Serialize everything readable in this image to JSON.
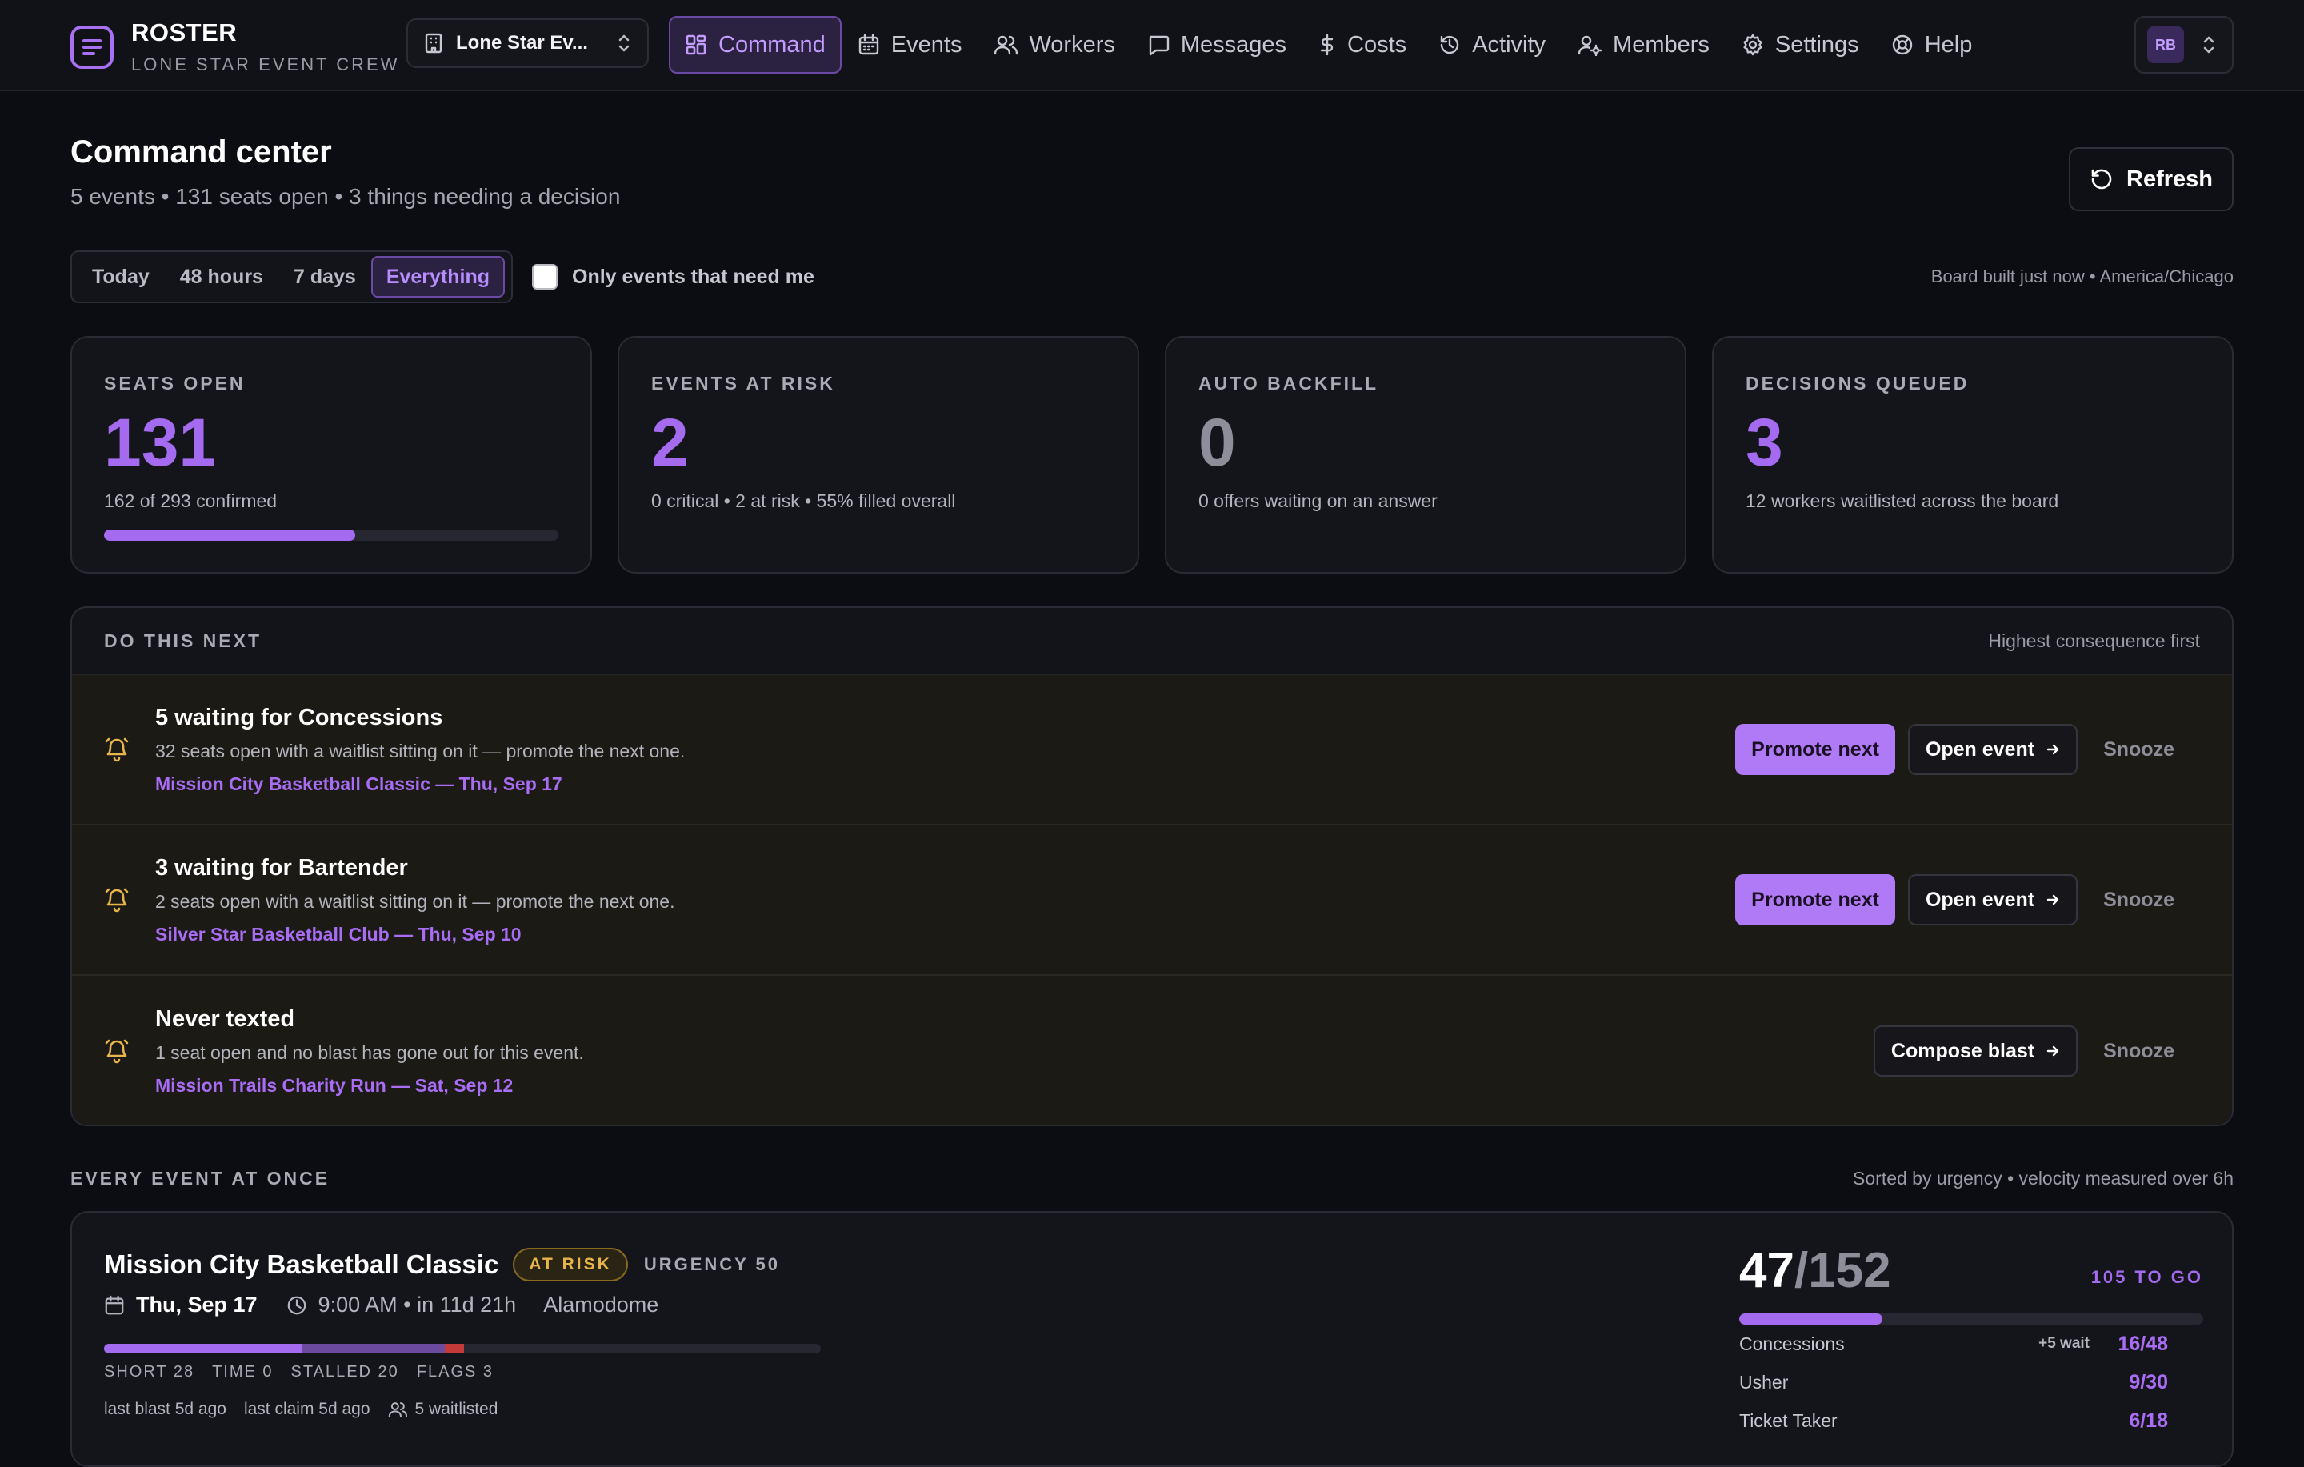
{
  "brand": {
    "title": "ROSTER",
    "subtitle": "LONE STAR EVENT CREW"
  },
  "org_selector": {
    "value": "Lone Star Ev..."
  },
  "nav": {
    "items": [
      {
        "label": "Command",
        "icon": "grid-icon",
        "active": true
      },
      {
        "label": "Events",
        "icon": "calendar-icon"
      },
      {
        "label": "Workers",
        "icon": "users-icon"
      },
      {
        "label": "Messages",
        "icon": "message-icon"
      },
      {
        "label": "Costs",
        "icon": "dollar-icon"
      },
      {
        "label": "Activity",
        "icon": "history-icon"
      },
      {
        "label": "Members",
        "icon": "user-cog-icon"
      },
      {
        "label": "Settings",
        "icon": "gear-icon"
      },
      {
        "label": "Help",
        "icon": "lifebuoy-icon"
      }
    ]
  },
  "user": {
    "initials": "RB"
  },
  "header": {
    "title": "Command center",
    "subtitle": "5 events • 131 seats open • 3 things needing a decision",
    "refresh_label": "Refresh"
  },
  "filters": {
    "ranges": [
      "Today",
      "48 hours",
      "7 days",
      "Everything"
    ],
    "selected_range": "Everything",
    "only_need_me_label": "Only events that need me",
    "only_need_me_checked": false,
    "board_meta": "Board built just now • America/Chicago"
  },
  "stats": [
    {
      "label": "SEATS OPEN",
      "value": "131",
      "detail": "162 of 293 confirmed",
      "progress": 0.553,
      "tone": "purple"
    },
    {
      "label": "EVENTS AT RISK",
      "value": "2",
      "detail": "0 critical • 2 at risk • 55% filled overall",
      "tone": "purple"
    },
    {
      "label": "AUTO BACKFILL",
      "value": "0",
      "detail": "0 offers waiting on an answer",
      "tone": "grey"
    },
    {
      "label": "DECISIONS QUEUED",
      "value": "3",
      "detail": "12 workers waitlisted across the board",
      "tone": "purple"
    }
  ],
  "next": {
    "label": "DO THIS NEXT",
    "note": "Highest consequence first",
    "items": [
      {
        "title": "5 waiting for Concessions",
        "desc": "32 seats open with a waitlist sitting on it — promote the next one.",
        "link": "Mission City Basketball Classic — Thu, Sep 17",
        "primary": "Promote next",
        "secondary": "Open event",
        "ghost": "Snooze"
      },
      {
        "title": "3 waiting for Bartender",
        "desc": "2 seats open with a waitlist sitting on it — promote the next one.",
        "link": "Silver Star Basketball Club — Thu, Sep 10",
        "primary": "Promote next",
        "secondary": "Open event",
        "ghost": "Snooze"
      },
      {
        "title": "Never texted",
        "desc": "1 seat open and no blast has gone out for this event.",
        "link": "Mission Trails Charity Run — Sat, Sep 12",
        "secondary": "Compose blast",
        "ghost": "Snooze"
      }
    ]
  },
  "events": {
    "label": "EVERY EVENT AT ONCE",
    "note": "Sorted by urgency • velocity measured over 6h",
    "items": [
      {
        "title": "Mission City Basketball Classic",
        "badge": "AT RISK",
        "urgency": "URGENCY 50",
        "date": "Thu, Sep 17",
        "time": "9:00 AM • in 11d 21h",
        "venue": "Alamodome",
        "tallies": [
          "SHORT 28",
          "TIME 0",
          "STALLED 20",
          "FLAGS 3"
        ],
        "last_blast": "last blast 5d ago",
        "last_claim": "last claim 5d ago",
        "waitlisted": "5 waitlisted",
        "filled": "47",
        "total": "/152",
        "to_go": "105 TO GO",
        "fill_ratio": 0.309,
        "roles": [
          {
            "name": "Concessions",
            "wait": "+5 wait",
            "count": "16/48"
          },
          {
            "name": "Usher",
            "wait": "",
            "count": "9/30"
          },
          {
            "name": "Ticket Taker",
            "wait": "",
            "count": "6/18"
          }
        ]
      }
    ]
  }
}
